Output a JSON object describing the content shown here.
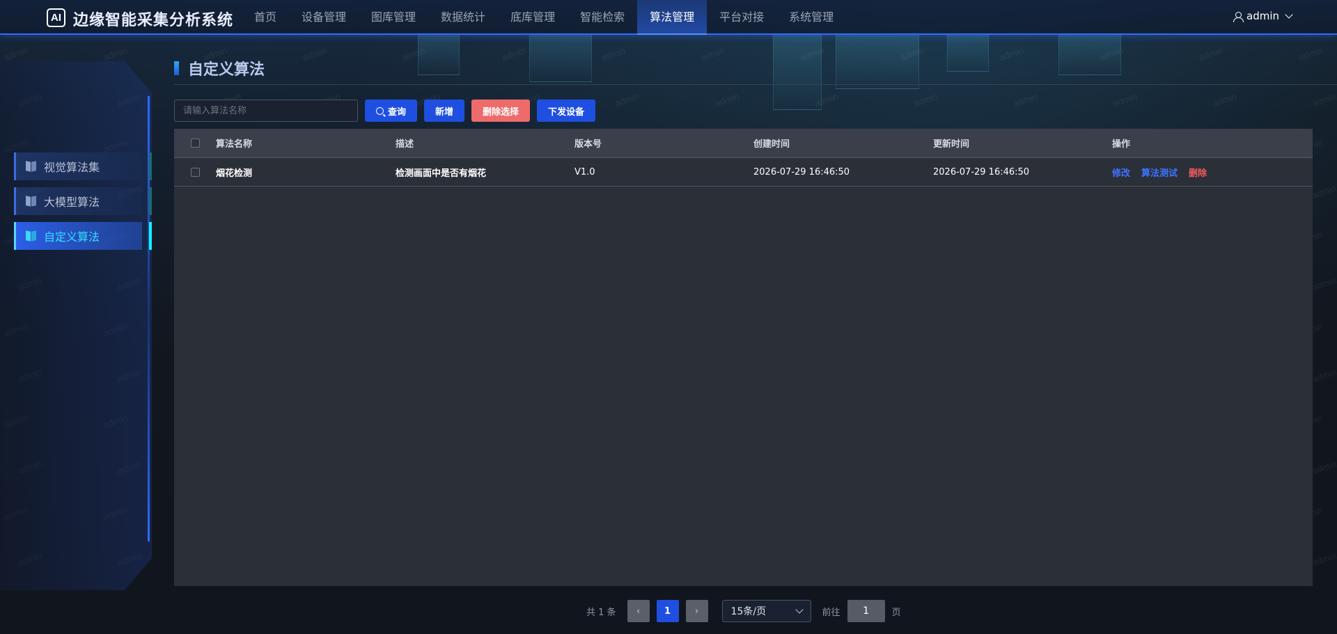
{
  "header": {
    "logo": "AI",
    "title": "边缘智能采集分析系统",
    "nav": [
      {
        "label": "首页"
      },
      {
        "label": "设备管理"
      },
      {
        "label": "图库管理"
      },
      {
        "label": "数据统计"
      },
      {
        "label": "底库管理"
      },
      {
        "label": "智能检索"
      },
      {
        "label": "算法管理",
        "active": true
      },
      {
        "label": "平台对接"
      },
      {
        "label": "系统管理"
      }
    ],
    "user": "admin"
  },
  "sidebar": {
    "items": [
      {
        "label": "视觉算法集"
      },
      {
        "label": "大模型算法"
      },
      {
        "label": "自定义算法",
        "active": true
      }
    ]
  },
  "main": {
    "title": "自定义算法",
    "search": {
      "placeholder": "请输入算法名称",
      "value": ""
    },
    "buttons": {
      "query": "查询",
      "add": "新增",
      "delete_selected": "删除选择",
      "dispatch": "下发设备"
    },
    "table": {
      "headers": [
        "算法名称",
        "描述",
        "版本号",
        "创建时间",
        "更新时间",
        "操作"
      ],
      "rows": [
        {
          "name": "烟花检测",
          "description": "检测画面中是否有烟花",
          "version": "V1.0",
          "created": "2026-07-29 16:46:50",
          "updated": "2026-07-29 16:46:50",
          "ops": {
            "edit": "修改",
            "test": "算法测试",
            "delete": "删除"
          }
        }
      ]
    },
    "pagination": {
      "total_text": "共 1 条",
      "current": "1",
      "page_size": "15条/页",
      "goto_label": "前往",
      "goto_value": "1",
      "page_unit": "页"
    }
  },
  "watermark": "admin",
  "colors": {
    "accent": "#1e4fe0",
    "danger": "#ee6b6b",
    "active_cyan": "#35e0ff"
  }
}
